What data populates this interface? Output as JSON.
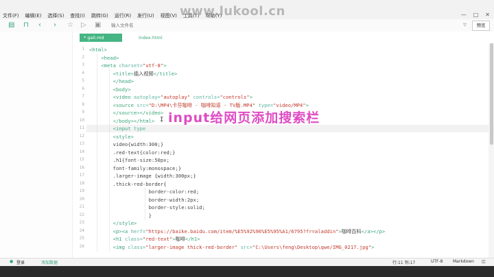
{
  "menubar": {
    "items": [
      "文件(F)",
      "编辑(E)",
      "选择(S)",
      "查找(I)",
      "跳转(G)",
      "运行(R)",
      "发行(U)",
      "视图(V)",
      "工具(T)",
      "帮助(Y)"
    ]
  },
  "watermark": "www.lukool.cn",
  "window_controls": {
    "min": "—",
    "max": "□",
    "close": "✕"
  },
  "toolbar": {
    "search_placeholder": "输入文件名",
    "preview_label": "预览"
  },
  "tabs": [
    {
      "label": "* gali.md",
      "active": true
    },
    {
      "label": "index.html",
      "active": false
    }
  ],
  "editor": {
    "lines": [
      {
        "n": "1",
        "indent": 0,
        "parts": [
          [
            "tag",
            "<html>"
          ]
        ]
      },
      {
        "n": "2",
        "indent": 1,
        "parts": [
          [
            "tag",
            "<head>"
          ]
        ]
      },
      {
        "n": "3",
        "indent": 1,
        "parts": [
          [
            "tag",
            "<meta "
          ],
          [
            "attr",
            "charset="
          ],
          [
            "str",
            "\"utf-8\""
          ],
          [
            "tag",
            ">"
          ]
        ]
      },
      {
        "n": "4",
        "indent": 2,
        "parts": [
          [
            "tag",
            "<title>"
          ],
          [
            "plain",
            "插入视频"
          ],
          [
            "tag",
            "</title>"
          ]
        ]
      },
      {
        "n": "5",
        "indent": 2,
        "parts": [
          [
            "tag",
            "</head>"
          ]
        ]
      },
      {
        "n": "6",
        "indent": 2,
        "parts": [
          [
            "tag",
            "<body>"
          ]
        ]
      },
      {
        "n": "7",
        "indent": 2,
        "parts": [
          [
            "tag",
            "<video "
          ],
          [
            "attr",
            "autoplay="
          ],
          [
            "str",
            "\"autoplay\""
          ],
          [
            "attr",
            " controls="
          ],
          [
            "str",
            "\"controls\""
          ],
          [
            "tag",
            ">"
          ]
        ]
      },
      {
        "n": "8",
        "indent": 2,
        "parts": [
          [
            "tag",
            "<source "
          ],
          [
            "attr",
            "src="
          ],
          [
            "str",
            "\"D:\\MP4\\卡芬咖啡 - 咖啡知道 - TV版.MP4\""
          ],
          [
            "attr",
            " type="
          ],
          [
            "str",
            "\"video/MP4\""
          ],
          [
            "tag",
            ">"
          ]
        ]
      },
      {
        "n": "9",
        "indent": 2,
        "parts": [
          [
            "tag",
            "</source></video>"
          ]
        ]
      },
      {
        "n": "10",
        "indent": 2,
        "parts": [
          [
            "tag",
            "</body></html>"
          ]
        ]
      },
      {
        "n": "11",
        "indent": 2,
        "parts": [
          [
            "tag",
            "<input "
          ],
          [
            "attr",
            "type"
          ]
        ]
      },
      {
        "n": "12",
        "indent": 2,
        "parts": [
          [
            "tag",
            "<style>"
          ]
        ]
      },
      {
        "n": "13",
        "indent": 2,
        "parts": [
          [
            "plain",
            "video{width:300;}"
          ]
        ]
      },
      {
        "n": "14",
        "indent": 2,
        "parts": [
          [
            "plain",
            ".red-text{color:red;}"
          ]
        ]
      },
      {
        "n": "15",
        "indent": 2,
        "parts": [
          [
            "plain",
            ".h1{font-size:50px;"
          ]
        ]
      },
      {
        "n": "16",
        "indent": 2,
        "parts": [
          [
            "plain",
            "font-family:monospace;}"
          ]
        ]
      },
      {
        "n": "17",
        "indent": 2,
        "parts": [
          [
            "plain",
            ".larger-image {width:300px;}"
          ]
        ]
      },
      {
        "n": "18",
        "indent": 2,
        "parts": [
          [
            "plain",
            ".thick-red-border{"
          ]
        ]
      },
      {
        "n": "19",
        "indent": 5,
        "parts": [
          [
            "plain",
            "border-color:red;"
          ]
        ]
      },
      {
        "n": "20",
        "indent": 5,
        "parts": [
          [
            "plain",
            "border-width:2px;"
          ]
        ]
      },
      {
        "n": "21",
        "indent": 5,
        "parts": [
          [
            "plain",
            "border-style:solid;"
          ]
        ]
      },
      {
        "n": "22",
        "indent": 5,
        "parts": [
          [
            "plain",
            "}"
          ]
        ]
      },
      {
        "n": "23",
        "indent": 2,
        "parts": [
          [
            "tag",
            "</style>"
          ]
        ]
      },
      {
        "n": "24",
        "indent": 2,
        "parts": [
          [
            "tag",
            "<p><a "
          ],
          [
            "attr",
            "herf="
          ],
          [
            "str",
            "\"https://baike.baidu.com/item/%E5%92%96%E5%95%A1/6795?fr=aladdin\""
          ],
          [
            "tag",
            ">"
          ],
          [
            "plain",
            "咖啡百科"
          ],
          [
            "tag",
            "</a></p>"
          ]
        ]
      },
      {
        "n": "25",
        "indent": 2,
        "parts": [
          [
            "tag",
            "<h1 "
          ],
          [
            "attr",
            "class="
          ],
          [
            "str",
            "\"red-text\""
          ],
          [
            "tag",
            ">"
          ],
          [
            "plain",
            "咖啡"
          ],
          [
            "tag",
            "</h1>"
          ]
        ]
      },
      {
        "n": "26",
        "indent": 2,
        "parts": [
          [
            "tag",
            "<img "
          ],
          [
            "attr",
            "class="
          ],
          [
            "str",
            "\"larger-image thick-red-border\""
          ],
          [
            "attr",
            " src="
          ],
          [
            "str",
            "\"C:\\Users\\feng\\Desktop\\qwe/IMG_0217.jpg\""
          ],
          [
            "tag",
            ">"
          ]
        ]
      }
    ],
    "highlight_line": 11
  },
  "overlay_caption": "input给网页添加搜索栏",
  "cursor_glyph": "I",
  "statusbar": {
    "login": "登录",
    "feedback": "添加数据",
    "position": "行:11  列:17",
    "encoding": "UTF-8",
    "language": "Markdown"
  },
  "colors": {
    "accent": "#45b583",
    "tag": "#3aa57a",
    "string": "#c0392b",
    "overlay": "#d71eb4"
  }
}
